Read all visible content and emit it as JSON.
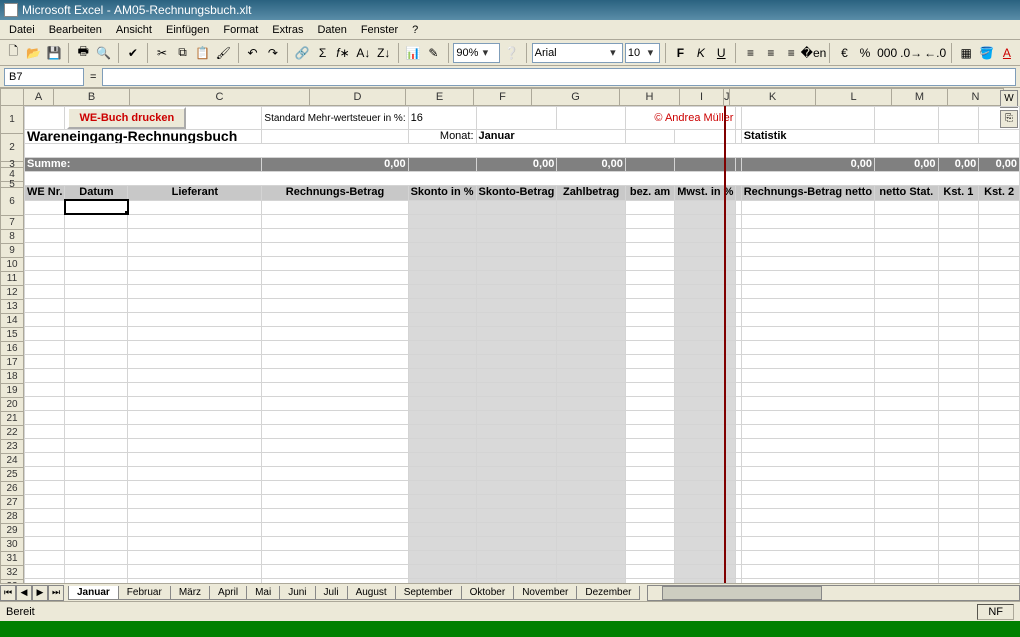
{
  "title_app": "Microsoft Excel",
  "title_file": "AM05-Rechnungsbuch.xlt",
  "menubar": [
    "Datei",
    "Bearbeiten",
    "Ansicht",
    "Einfügen",
    "Format",
    "Extras",
    "Daten",
    "Fenster",
    "?"
  ],
  "zoom": "90%",
  "font_name": "Arial",
  "font_size": "10",
  "currency_icon": "€",
  "percent_icon": "%",
  "thousand_icon": "000",
  "namebox": "B7",
  "columns": [
    "A",
    "B",
    "C",
    "D",
    "E",
    "F",
    "G",
    "H",
    "I",
    "J",
    "K",
    "L",
    "M",
    "N"
  ],
  "rows_first": 34,
  "content": {
    "print_btn": "WE-Buch drucken",
    "vat_label": "Standard Mehr-wertsteuer in %:",
    "vat_value": "16",
    "copyright": "© Andrea Müller",
    "book_title": "Wareneingang-Rechnungsbuch",
    "month_label": "Monat:",
    "month_value": "Januar",
    "stats_label": "Statistik",
    "sum_label": "Summe:",
    "zero": "0,00",
    "headers": {
      "we_nr": "WE Nr.",
      "datum": "Datum",
      "lieferant": "Lieferant",
      "rech_betrag": "Rechnungs-Betrag",
      "skonto_pct": "Skonto in %",
      "skonto_betrag": "Skonto-Betrag",
      "zahlbetrag": "Zahlbetrag",
      "bez_am": "bez. am",
      "mwst": "Mwst. in %",
      "rech_netto": "Rechnungs-Betrag netto",
      "netto_stat": "netto Stat.",
      "kst1": "Kst. 1",
      "kst2": "Kst. 2"
    }
  },
  "sheet_tabs": [
    "Januar",
    "Februar",
    "März",
    "April",
    "Mai",
    "Juni",
    "Juli",
    "August",
    "September",
    "Oktober",
    "November",
    "Dezember"
  ],
  "active_tab": 0,
  "status": "Bereit",
  "status_right": "NF"
}
